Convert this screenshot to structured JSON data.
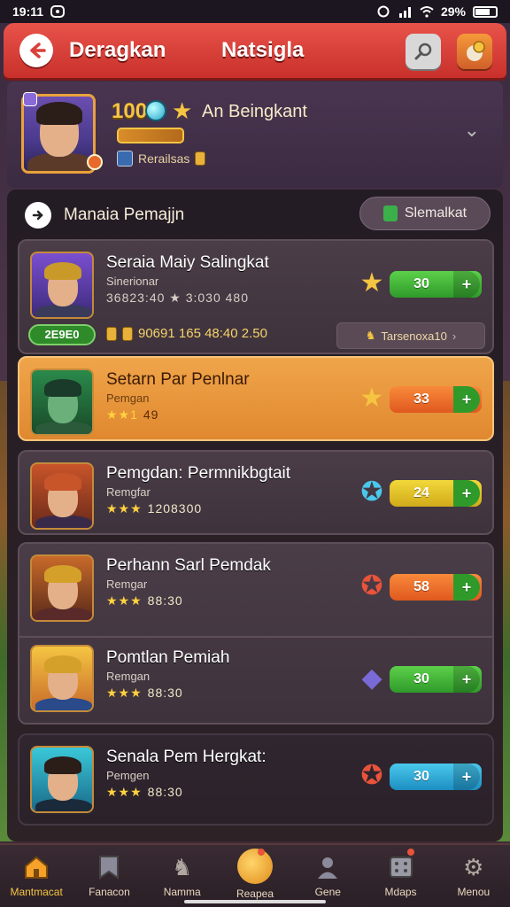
{
  "status_bar": {
    "time": "19:11",
    "battery": "29%"
  },
  "header": {
    "title": "Deragkan",
    "center_title": "Natsigla"
  },
  "profile": {
    "level": "100",
    "name": "An Beingkant",
    "rank_label": "Rerailsas"
  },
  "list": {
    "title": "Manaia Pemajjn",
    "action_label": "Slemalkat"
  },
  "cards": [
    {
      "name": "Seraia Maiy Salingkat",
      "sub": "Sinerionar",
      "stars": "",
      "stats_line": "36823:40 ★ 3:030 480",
      "value": "30",
      "color": "green",
      "badge": "2E9E0",
      "footer_stats": "90691 165 48:40 2.50",
      "footer_link": "Tarsenoxa10"
    },
    {
      "name": "Setarn Par Penlnar",
      "sub": "Pemgan",
      "stars": "★★1",
      "num": "49",
      "value": "33",
      "color": "orange"
    },
    {
      "name": "Pemgdan: Permnikbgtait",
      "sub": "Remgfar",
      "stars": "★★★",
      "num": "1208300",
      "value": "24",
      "color": "yellow"
    },
    {
      "name": "Perhann Sarl Pemdak",
      "sub": "Remgar",
      "stars": "★★★",
      "num": "88:30",
      "value": "58",
      "color": "orange"
    },
    {
      "name": "Pomtlan Pemiah",
      "sub": "Remgan",
      "stars": "★★★",
      "num": "88:30",
      "value": "30",
      "color": "green"
    },
    {
      "name": "Senala Pem Hergkat:",
      "sub": "Pemgen",
      "stars": "★★★",
      "num": "88:30",
      "value": "30",
      "color": "blue"
    }
  ],
  "nav": [
    {
      "label": "Mantmacat",
      "icon": "home-icon"
    },
    {
      "label": "Fanacon",
      "icon": "banner-icon"
    },
    {
      "label": "Namma",
      "icon": "bird-icon"
    },
    {
      "label": "Reapea",
      "icon": "coin-icon"
    },
    {
      "label": "Gene",
      "icon": "person-icon"
    },
    {
      "label": "Mdaps",
      "icon": "grid-icon"
    },
    {
      "label": "Menou",
      "icon": "gear-icon"
    }
  ],
  "colors": {
    "accent": "#d9413a",
    "gold": "#f5c542",
    "highlight": "#e98f36"
  }
}
